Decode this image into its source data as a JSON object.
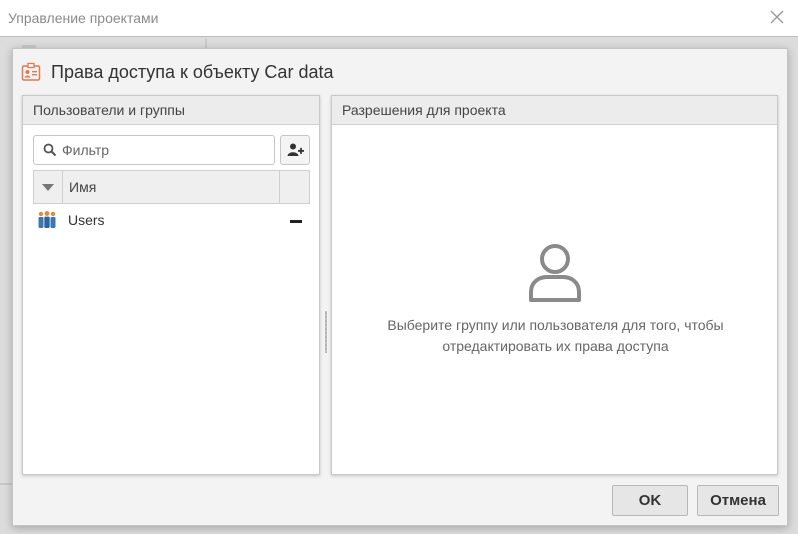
{
  "window": {
    "title": "Управление проектами",
    "close_icon": "close-icon"
  },
  "dialog": {
    "title": "Права доступа к объекту Car data",
    "icon": "permissions-badge-icon",
    "left_panel": {
      "header": "Пользователи и группы",
      "filter_placeholder": "Фильтр",
      "column_name": "Имя",
      "rows": [
        {
          "label": "Users",
          "icon": "group-icon"
        }
      ]
    },
    "right_panel": {
      "header": "Разрешения для проекта",
      "placeholder_line1": "Выберите группу или пользователя для того, чтобы",
      "placeholder_line2": "отредактировать их права доступа",
      "placeholder_icon": "user-icon"
    },
    "buttons": {
      "ok": "OK",
      "cancel": "Отмена"
    }
  },
  "colors": {
    "accent": "#e07a50",
    "group_icon_blue": "#3a78b5",
    "placeholder_icon": "#8a8a8a"
  }
}
